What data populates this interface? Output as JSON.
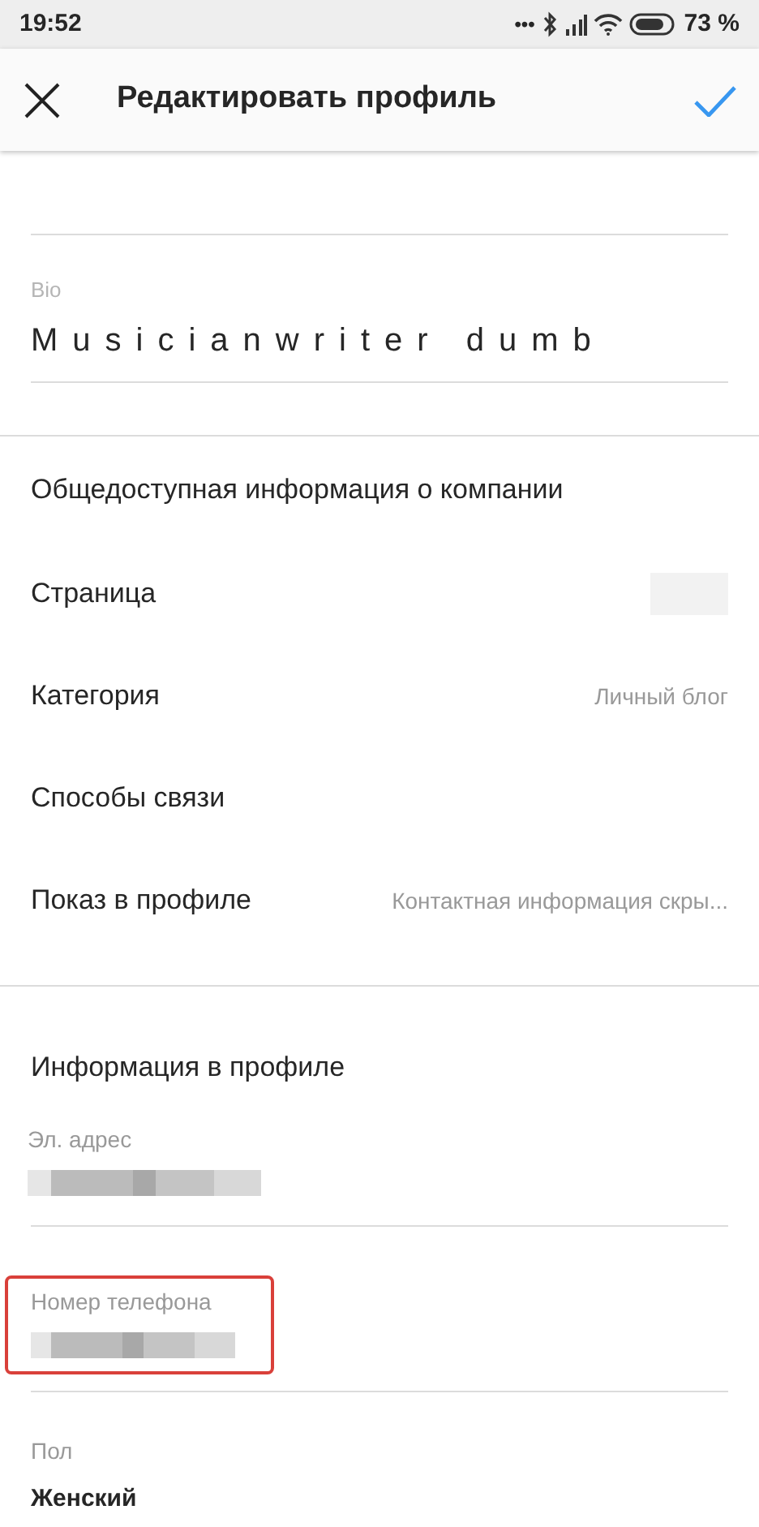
{
  "status_bar": {
    "time": "19:52",
    "notification_dots": "•••",
    "battery": "73 %"
  },
  "header": {
    "title": "Редактировать профиль"
  },
  "bio": {
    "label": "Bio",
    "value": "Musicianwriter dumb"
  },
  "business": {
    "title": "Общедоступная информация о компании",
    "rows": [
      {
        "label": "Страница",
        "redacted": true
      },
      {
        "label": "Категория",
        "value": "Личный блог"
      },
      {
        "label": "Способы связи"
      },
      {
        "label": "Показ в профиле",
        "value": "Контактная информация скры..."
      }
    ]
  },
  "profile_info": {
    "title": "Информация в профиле",
    "fields": [
      {
        "label": "Эл. адрес",
        "redacted": true,
        "highlighted": false
      },
      {
        "label": "Номер телефона",
        "redacted": true,
        "highlighted": true
      }
    ]
  },
  "gender": {
    "label": "Пол",
    "value": "Женский"
  }
}
